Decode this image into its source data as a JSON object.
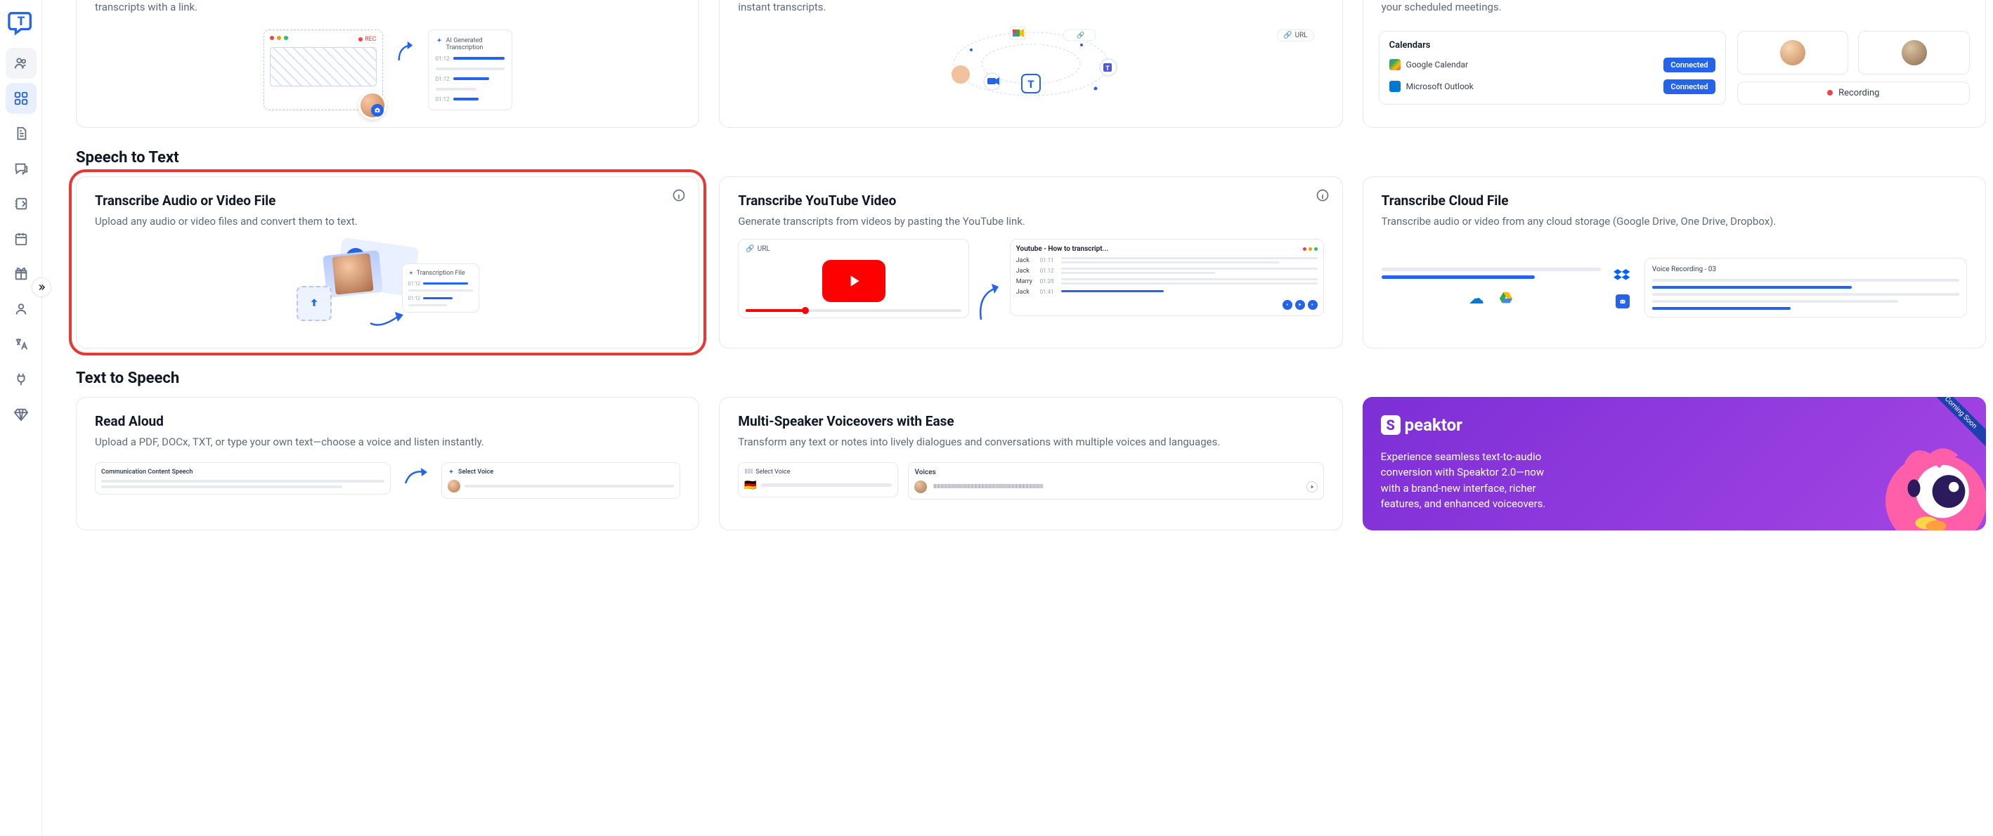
{
  "sidebar": {
    "logo_letter": "T"
  },
  "top_row": [
    {
      "desc_suffix": "transcripts with a link."
    },
    {
      "desc_suffix": "instant transcripts."
    },
    {
      "desc_suffix": "your scheduled meetings."
    }
  ],
  "top_illus": {
    "ai_transcription_label": "AI Generated\nTranscription",
    "url_label": "URL",
    "rec_label": "REC",
    "times": [
      "01:12",
      "01:12",
      "01:12"
    ],
    "calendars_title": "Calendars",
    "google_calendar": "Google Calendar",
    "ms_outlook": "Microsoft Outlook",
    "connected": "Connected",
    "recording": "Recording"
  },
  "sections": {
    "speech_to_text": "Speech to Text",
    "text_to_speech": "Text to Speech"
  },
  "speech_cards": [
    {
      "title": "Transcribe Audio or Video File",
      "desc": "Upload any audio or video files and convert them to text.",
      "illus": {
        "transcription_file": "Transcription File",
        "t1": "01:12",
        "t2": "01:12"
      }
    },
    {
      "title": "Transcribe YouTube Video",
      "desc": "Generate transcripts from videos by pasting the YouTube link.",
      "illus": {
        "url_label": "URL",
        "yt_title": "Youtube - How to transcript...",
        "rows": [
          {
            "name": "Jack",
            "time": "01:11"
          },
          {
            "name": "Jack",
            "time": "01:12"
          },
          {
            "name": "Marry",
            "time": "01:35"
          },
          {
            "name": "Jack",
            "time": "01:41"
          }
        ]
      }
    },
    {
      "title": "Transcribe Cloud File",
      "desc": "Transcribe audio or video from any cloud storage (Google Drive, One Drive, Dropbox).",
      "illus": {
        "voice_rec": "Voice Recording - 03"
      }
    }
  ],
  "tts_cards": [
    {
      "title": "Read Aloud",
      "desc": "Upload a PDF, DOCx, TXT, or type your own text—choose a voice and listen instantly.",
      "illus": {
        "left_label": "Communication Content Speech",
        "right_label": "Select Voice"
      }
    },
    {
      "title": "Multi-Speaker Voiceovers with Ease",
      "desc": "Transform any text or notes into lively dialogues and conversations with multiple voices and languages.",
      "illus": {
        "select_voice": "Select Voice",
        "voices": "Voices"
      }
    }
  ],
  "speaktor": {
    "brand": "peaktor",
    "brand_mark": "S",
    "desc": "Experience seamless text-to-audio conversion with Speaktor 2.0—now with a brand-new interface, richer features, and enhanced voiceovers.",
    "coming_soon": "Coming Soon"
  }
}
